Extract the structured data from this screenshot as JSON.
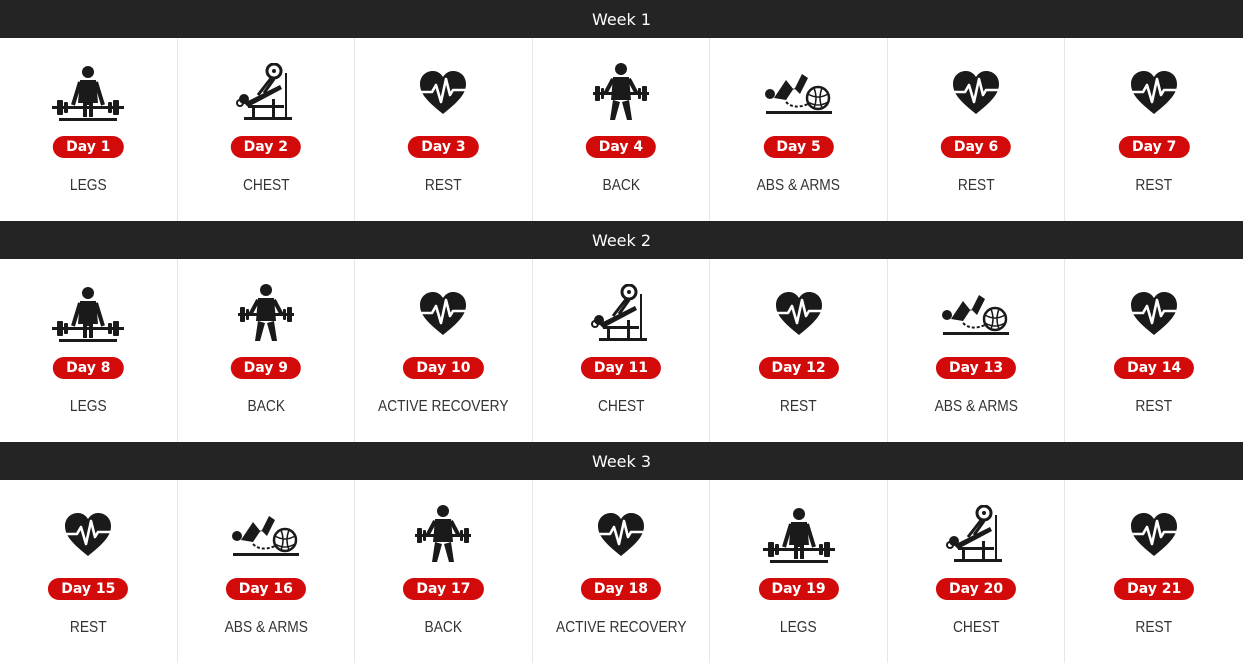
{
  "accent_color": "#d20a0a",
  "header_color": "#242424",
  "weeks": [
    {
      "label": "Week 1",
      "days": [
        {
          "day": "Day 1",
          "name": "LEGS",
          "icon": "deadlift-icon"
        },
        {
          "day": "Day 2",
          "name": "CHEST",
          "icon": "bench-press-icon"
        },
        {
          "day": "Day 3",
          "name": "REST",
          "icon": "heartbeat-icon"
        },
        {
          "day": "Day 4",
          "name": "BACK",
          "icon": "barbell-row-icon"
        },
        {
          "day": "Day 5",
          "name": "ABS & ARMS",
          "icon": "ab-ball-icon"
        },
        {
          "day": "Day 6",
          "name": "REST",
          "icon": "heartbeat-icon"
        },
        {
          "day": "Day 7",
          "name": "REST",
          "icon": "heartbeat-icon"
        }
      ]
    },
    {
      "label": "Week 2",
      "days": [
        {
          "day": "Day 8",
          "name": "LEGS",
          "icon": "deadlift-icon"
        },
        {
          "day": "Day 9",
          "name": "BACK",
          "icon": "barbell-row-icon"
        },
        {
          "day": "Day 10",
          "name": "ACTIVE RECOVERY",
          "icon": "heartbeat-icon"
        },
        {
          "day": "Day 11",
          "name": "CHEST",
          "icon": "bench-press-icon"
        },
        {
          "day": "Day 12",
          "name": "REST",
          "icon": "heartbeat-icon"
        },
        {
          "day": "Day 13",
          "name": "ABS & ARMS",
          "icon": "ab-ball-icon"
        },
        {
          "day": "Day 14",
          "name": "REST",
          "icon": "heartbeat-icon"
        }
      ]
    },
    {
      "label": "Week 3",
      "days": [
        {
          "day": "Day 15",
          "name": "REST",
          "icon": "heartbeat-icon"
        },
        {
          "day": "Day 16",
          "name": "ABS & ARMS",
          "icon": "ab-ball-icon"
        },
        {
          "day": "Day 17",
          "name": "BACK",
          "icon": "barbell-row-icon"
        },
        {
          "day": "Day 18",
          "name": "ACTIVE RECOVERY",
          "icon": "heartbeat-icon"
        },
        {
          "day": "Day 19",
          "name": "LEGS",
          "icon": "deadlift-icon"
        },
        {
          "day": "Day 20",
          "name": "CHEST",
          "icon": "bench-press-icon"
        },
        {
          "day": "Day 21",
          "name": "REST",
          "icon": "heartbeat-icon"
        }
      ]
    }
  ]
}
